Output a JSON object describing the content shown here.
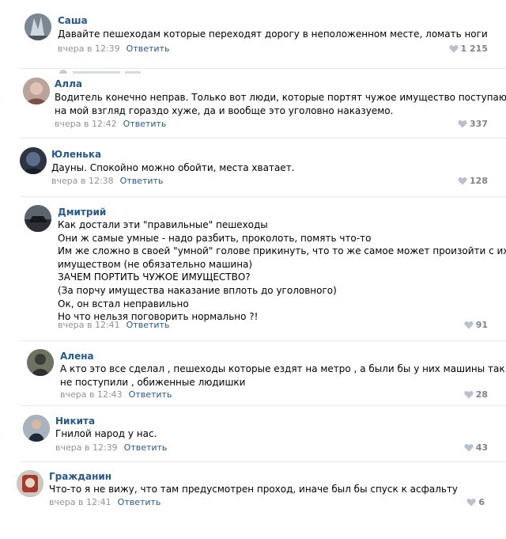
{
  "comments": [
    {
      "author": "Саша",
      "lines": [
        "Давайте пешеходам которые переходят дорогу в неположенном месте, ломать ноги"
      ],
      "time": "вчера в 12:39",
      "reply": "Ответить",
      "likes": "1 215"
    },
    {
      "author": "Алла",
      "lines": [
        "Водитель конечно неправ. Только вот люди, которые портят чужое имущество поступают",
        "на мой взгляд гораздо хуже, да и вообще это уголовно наказуемо."
      ],
      "time": "вчера в 12:42",
      "reply": "Ответить",
      "likes": "337"
    },
    {
      "author": "Юленька",
      "lines": [
        "Дауны. Спокойно можно обойти, места хватает."
      ],
      "time": "вчера в 12:38",
      "reply": "Ответить",
      "likes": "128"
    },
    {
      "author": "Дмитрий",
      "lines": [
        "Как достали эти \"правильные\" пешеходы",
        "Они ж самые умные - надо разбить, проколоть, помять что-то",
        "Им же сложно в своей \"умной\" голове прикинуть, что то же самое может произойти с их",
        "имуществом (не обязательно машина)",
        "ЗАЧЕМ ПОРТИТЬ ЧУЖОЕ ИМУЩЕСТВО?",
        "(За порчу имущества наказание вплоть до уголовного)",
        "Ок, он встал неправильно",
        "Но что нельзя поговорить нормально ?!"
      ],
      "time": "вчера в 12:41",
      "reply": "Ответить",
      "likes": "91"
    },
    {
      "author": "Алена",
      "lines": [
        "А кто это все сделал , пешеходы которые ездят на метро , а были бы у них машины так бы",
        "не поступили , обиженные людишки"
      ],
      "time": "вчера в 12:43",
      "reply": "Ответить",
      "likes": "28"
    },
    {
      "author": "Никита",
      "lines": [
        "Гнилой народ у нас."
      ],
      "time": "вчера в 12:39",
      "reply": "Ответить",
      "likes": "43"
    },
    {
      "author": "Гражданин",
      "lines": [
        "Что-то я не вижу, что там предусмотрен проход, иначе был бы спуск к асфальту"
      ],
      "time": "вчера в 12:41",
      "reply": "Ответить",
      "likes": "6"
    }
  ],
  "colors": {
    "link": "#2a5885",
    "meta": "#939393",
    "likes": "#828282",
    "separator": "#e7e8ec"
  },
  "icons": {
    "likes": "heart-icon"
  }
}
